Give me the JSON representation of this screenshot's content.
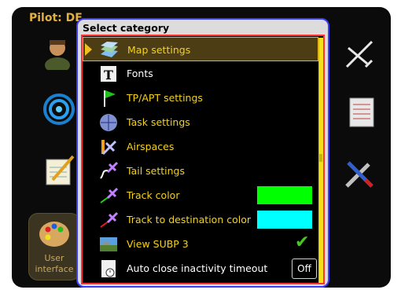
{
  "background": {
    "pilot_label": "Pilot: DE",
    "user_interface_label_1": "User",
    "user_interface_label_2": "interface"
  },
  "dialog": {
    "title": "Select category",
    "items": [
      {
        "label": "Map settings",
        "icon": "map-icon",
        "selected": true
      },
      {
        "label": "Fonts",
        "icon": "font-icon"
      },
      {
        "label": "TP/APT settings",
        "icon": "flag-icon"
      },
      {
        "label": "Task settings",
        "icon": "task-icon"
      },
      {
        "label": "Airspaces",
        "icon": "airspace-icon"
      },
      {
        "label": "Tail settings",
        "icon": "tail-icon"
      },
      {
        "label": "Track color",
        "icon": "track-icon",
        "swatch": "#00ff00"
      },
      {
        "label": "Track to destination color",
        "icon": "track-destination-icon",
        "swatch": "#00ffff"
      },
      {
        "label": "View SUBP 3",
        "icon": "landscape-icon",
        "checked": true
      },
      {
        "label": "Auto close inactivity timeout",
        "icon": "timer-icon",
        "value": "Off"
      }
    ]
  },
  "colors": {
    "accent": "#f2c01a",
    "highlight_bg": "#4c3d15",
    "dialog_border": "#3c3cff",
    "list_border": "#ff3030"
  }
}
